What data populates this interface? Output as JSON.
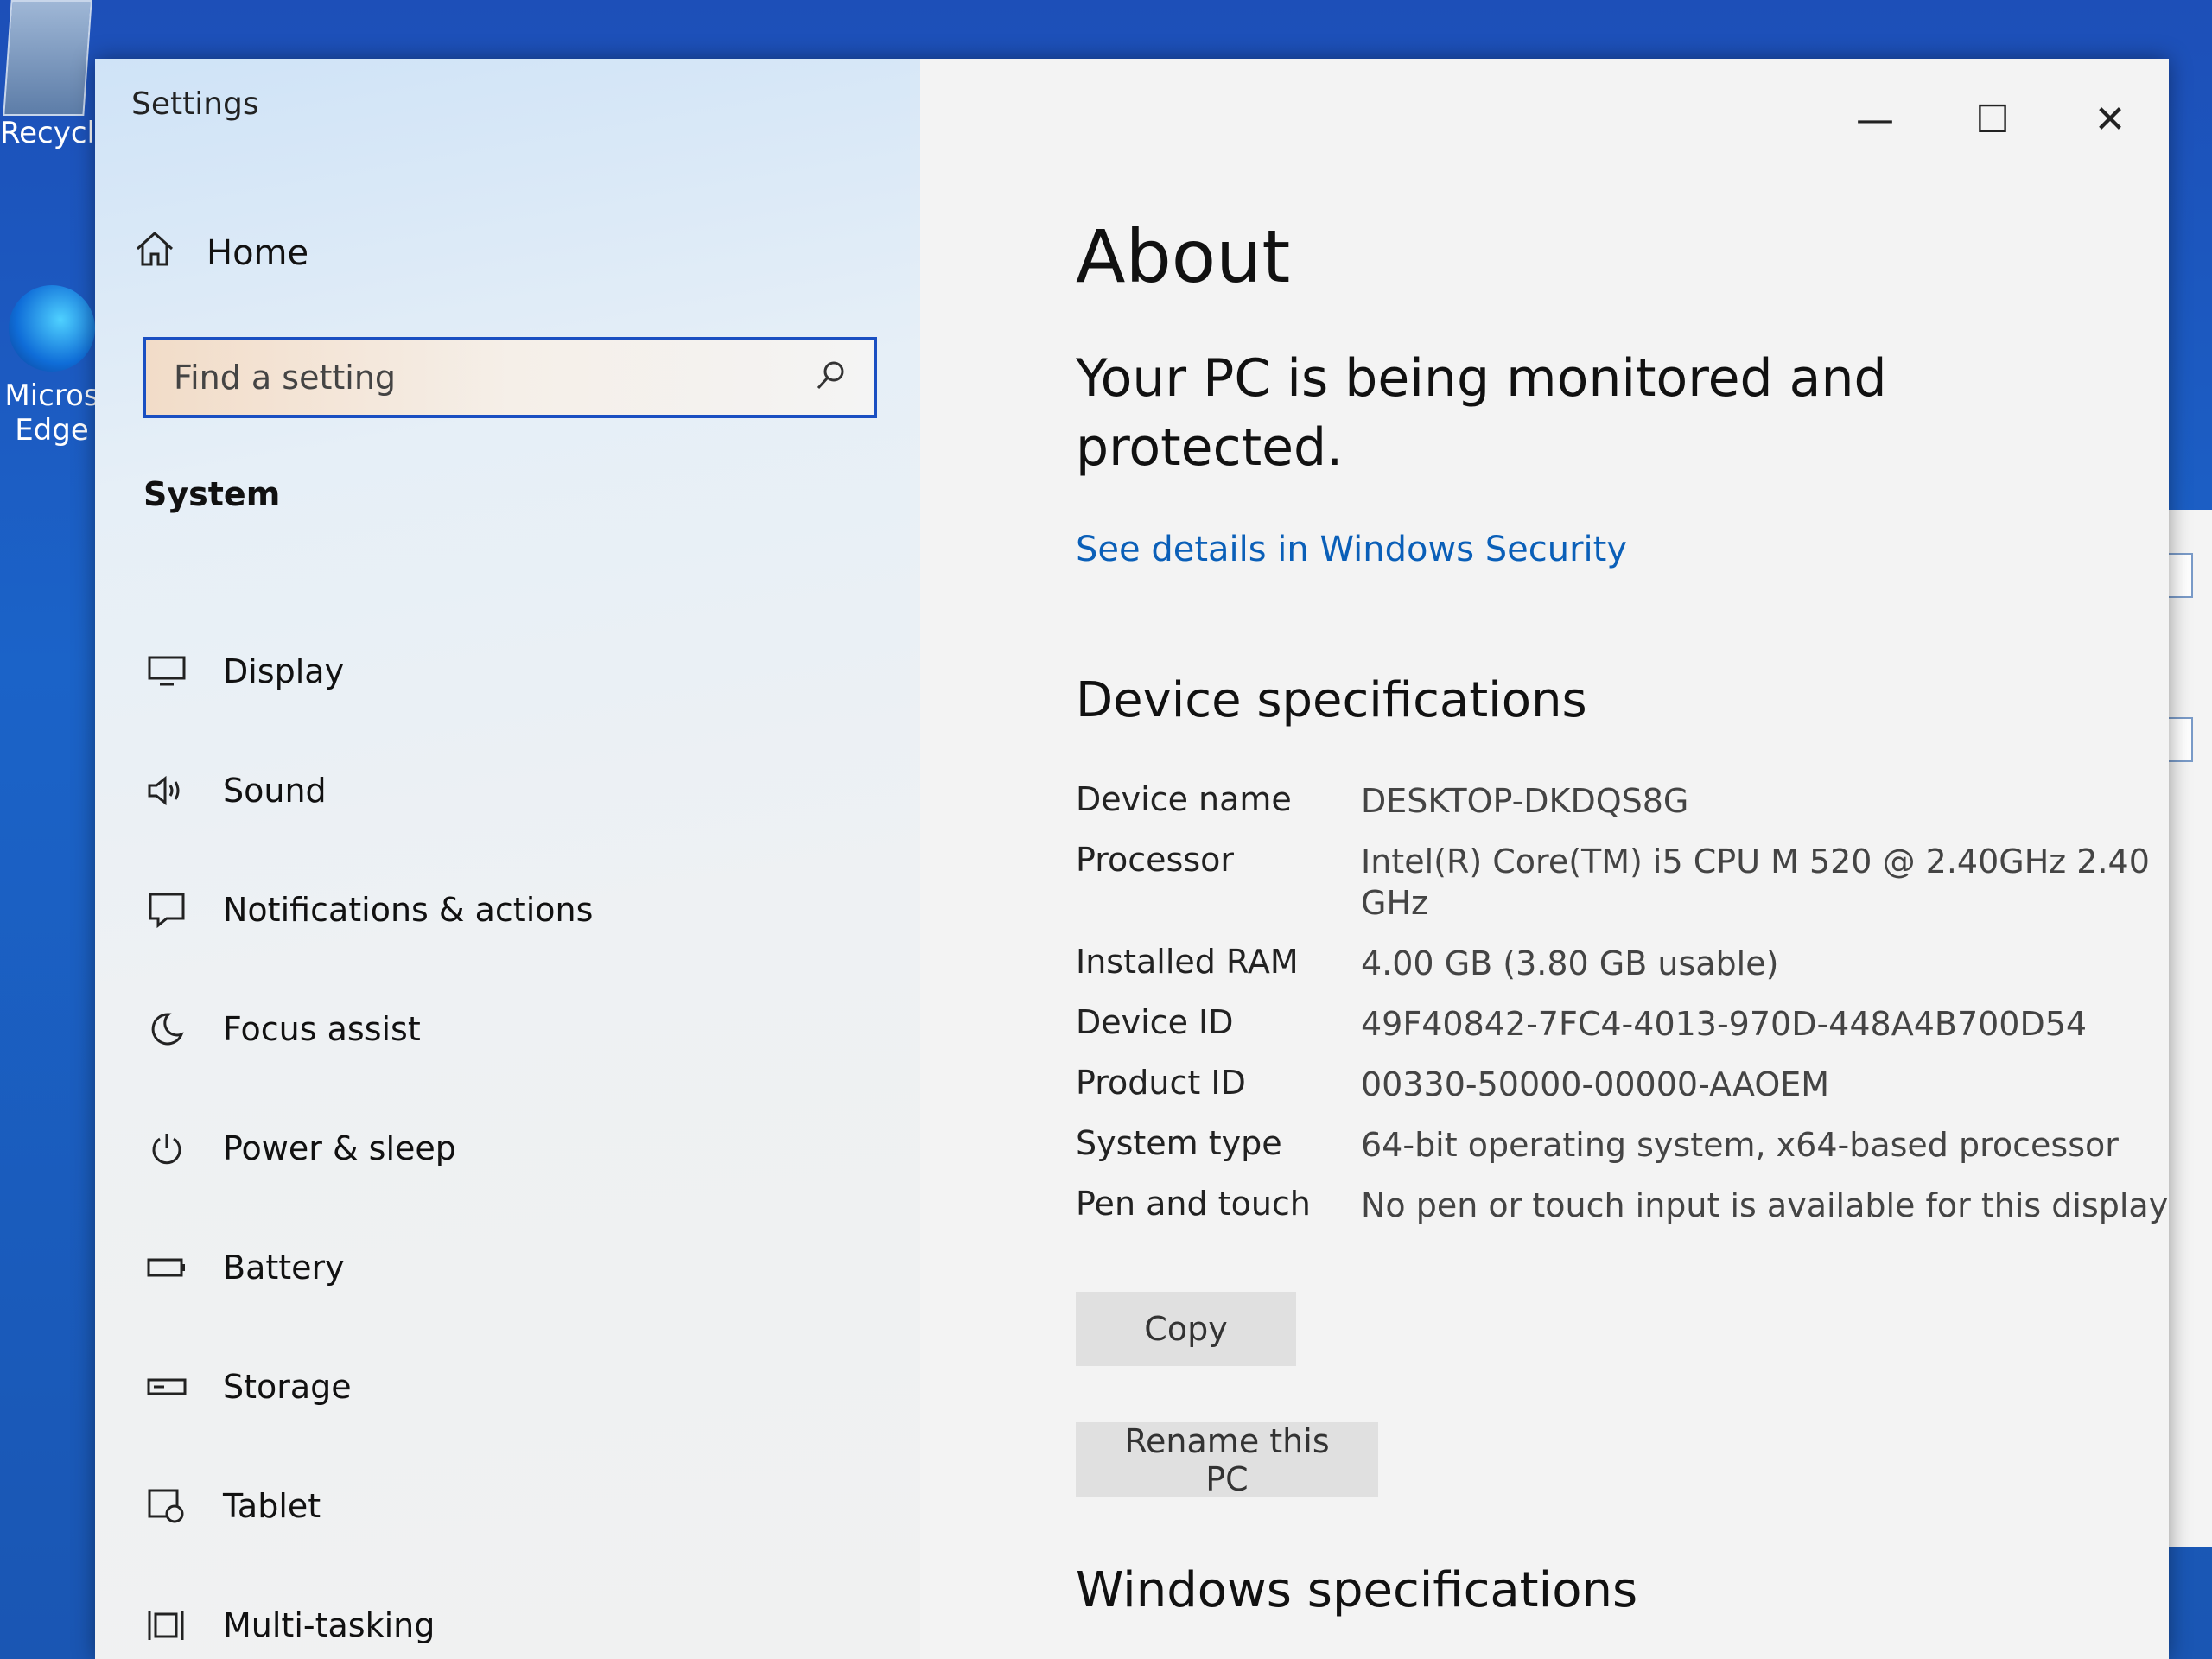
{
  "desktop": {
    "recycle_label": "Recycle",
    "edge_label_1": "Micros",
    "edge_label_2": "Edge"
  },
  "window": {
    "title": "Settings",
    "minimize": "—",
    "maximize": "☐",
    "close": "✕"
  },
  "nav": {
    "home_label": "Home",
    "search_placeholder": "Find a setting",
    "section": "System",
    "items": [
      {
        "label": "Display",
        "icon": "display-icon"
      },
      {
        "label": "Sound",
        "icon": "speaker-icon"
      },
      {
        "label": "Notifications & actions",
        "icon": "notification-icon"
      },
      {
        "label": "Focus assist",
        "icon": "moon-icon"
      },
      {
        "label": "Power & sleep",
        "icon": "power-icon"
      },
      {
        "label": "Battery",
        "icon": "battery-icon"
      },
      {
        "label": "Storage",
        "icon": "storage-icon"
      },
      {
        "label": "Tablet",
        "icon": "tablet-icon"
      },
      {
        "label": "Multi-tasking",
        "icon": "multitasking-icon"
      }
    ]
  },
  "content": {
    "title": "About",
    "monitored": "Your PC is being monitored and protected.",
    "security_link": "See details in Windows Security",
    "device_spec_title": "Device specifications",
    "specs": [
      {
        "key": "Device name",
        "value": "DESKTOP-DKDQS8G"
      },
      {
        "key": "Processor",
        "value": "Intel(R) Core(TM) i5 CPU M 520 @ 2.40GHz 2.40 GHz"
      },
      {
        "key": "Installed RAM",
        "value": "4.00 GB (3.80 GB usable)"
      },
      {
        "key": "Device ID",
        "value": "49F40842-7FC4-4013-970D-448A4B700D54"
      },
      {
        "key": "Product ID",
        "value": "00330-50000-00000-AAOEM"
      },
      {
        "key": "System type",
        "value": "64-bit operating system, x64-based processor"
      },
      {
        "key": "Pen and touch",
        "value": "No pen or touch input is available for this display"
      }
    ],
    "copy_label": "Copy",
    "rename_label": "Rename this PC",
    "windows_spec_title": "Windows specifications"
  }
}
